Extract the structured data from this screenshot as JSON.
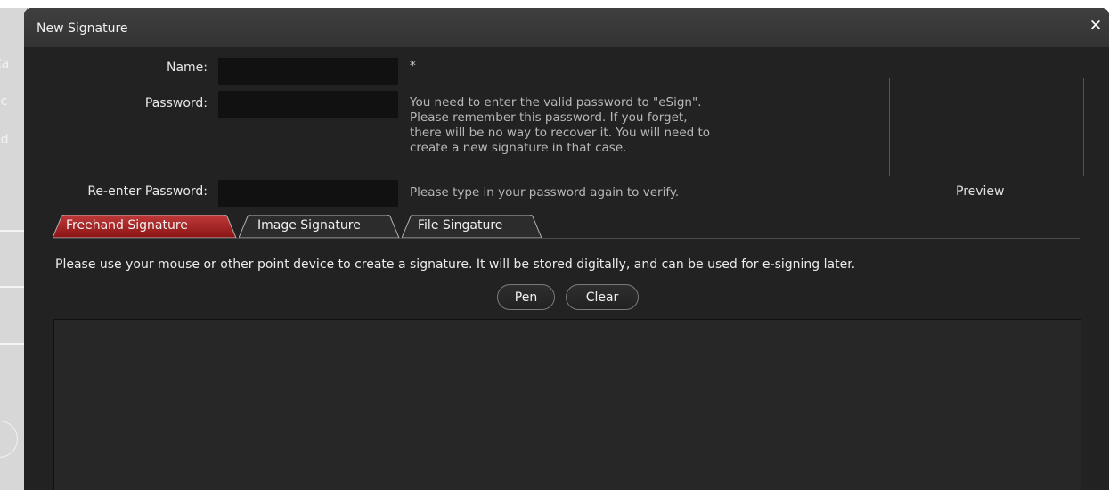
{
  "background_app": {
    "fragments": [
      "Ca",
      "ec",
      "ed"
    ]
  },
  "dialog": {
    "title": "New Signature",
    "close_icon": "close-icon",
    "close_glyph": "✕"
  },
  "form": {
    "name_label": "Name:",
    "name_value": "",
    "required_marker": "*",
    "password_label": "Password:",
    "password_value": "",
    "password_hint": "You need to enter the valid password to \"eSign\". Please remember this password. If you forget, there will be no way to recover it. You will need to create a new signature in that case.",
    "password_hint_lines": [
      "You need to enter the valid password to \"eSign\".",
      "Please remember this password. If you forget,",
      "there will be no way to recover it. You will need to",
      "create a new signature in that case."
    ],
    "reenter_label": "Re-enter Password:",
    "reenter_value": "",
    "reenter_hint": "Please type in your password again to verify."
  },
  "preview": {
    "label": "Preview"
  },
  "tabs": [
    {
      "label": "Freehand Signature",
      "active": true
    },
    {
      "label": "Image Signature",
      "active": false
    },
    {
      "label": "File Singature",
      "active": false
    }
  ],
  "freehand": {
    "instructions": "Please use your mouse or other point device to create a signature. It will be stored digitally, and can be used for e-signing later.",
    "pen_label": "Pen",
    "clear_label": "Clear"
  },
  "colors": {
    "dialog_bg": "#222222",
    "titlebar": "#3a3a3a",
    "active_tab": "#9b1c1c",
    "inactive_tab": "#2c2c2c",
    "input_bg": "#111111"
  }
}
